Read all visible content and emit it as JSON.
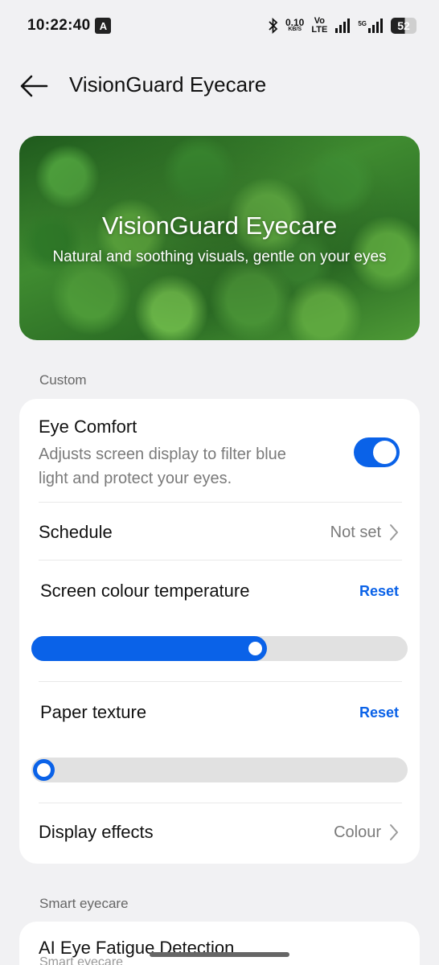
{
  "status_bar": {
    "time": "10:22:40",
    "a_badge": "A",
    "net_speed": "0.10",
    "net_unit": "KB/S",
    "volte_top": "Vo",
    "volte_bottom": "LTE",
    "signal_5g": "5G",
    "battery": "52"
  },
  "header": {
    "title": "VisionGuard Eyecare"
  },
  "banner": {
    "title": "VisionGuard Eyecare",
    "subtitle": "Natural and soothing visuals, gentle on your eyes"
  },
  "sections": {
    "custom_label": "Custom",
    "smart_label": "Smart eyecare",
    "smart_ghost": "Smart eyecare"
  },
  "settings": {
    "eye_comfort": {
      "title": "Eye Comfort",
      "description": "Adjusts screen display to filter blue light and protect your eyes.",
      "enabled": true
    },
    "schedule": {
      "title": "Schedule",
      "value": "Not set"
    },
    "colour_temperature": {
      "title": "Screen colour temperature",
      "reset_label": "Reset",
      "level_fraction": 0.6
    },
    "paper_texture": {
      "title": "Paper texture",
      "reset_label": "Reset",
      "level_fraction": 0.0
    },
    "display_effects": {
      "title": "Display effects",
      "value": "Colour"
    },
    "ai_fatigue": {
      "title": "AI Eye Fatigue Detection"
    }
  },
  "colors": {
    "accent": "#0a62e8",
    "background": "#f1f1f3",
    "card": "#ffffff"
  }
}
